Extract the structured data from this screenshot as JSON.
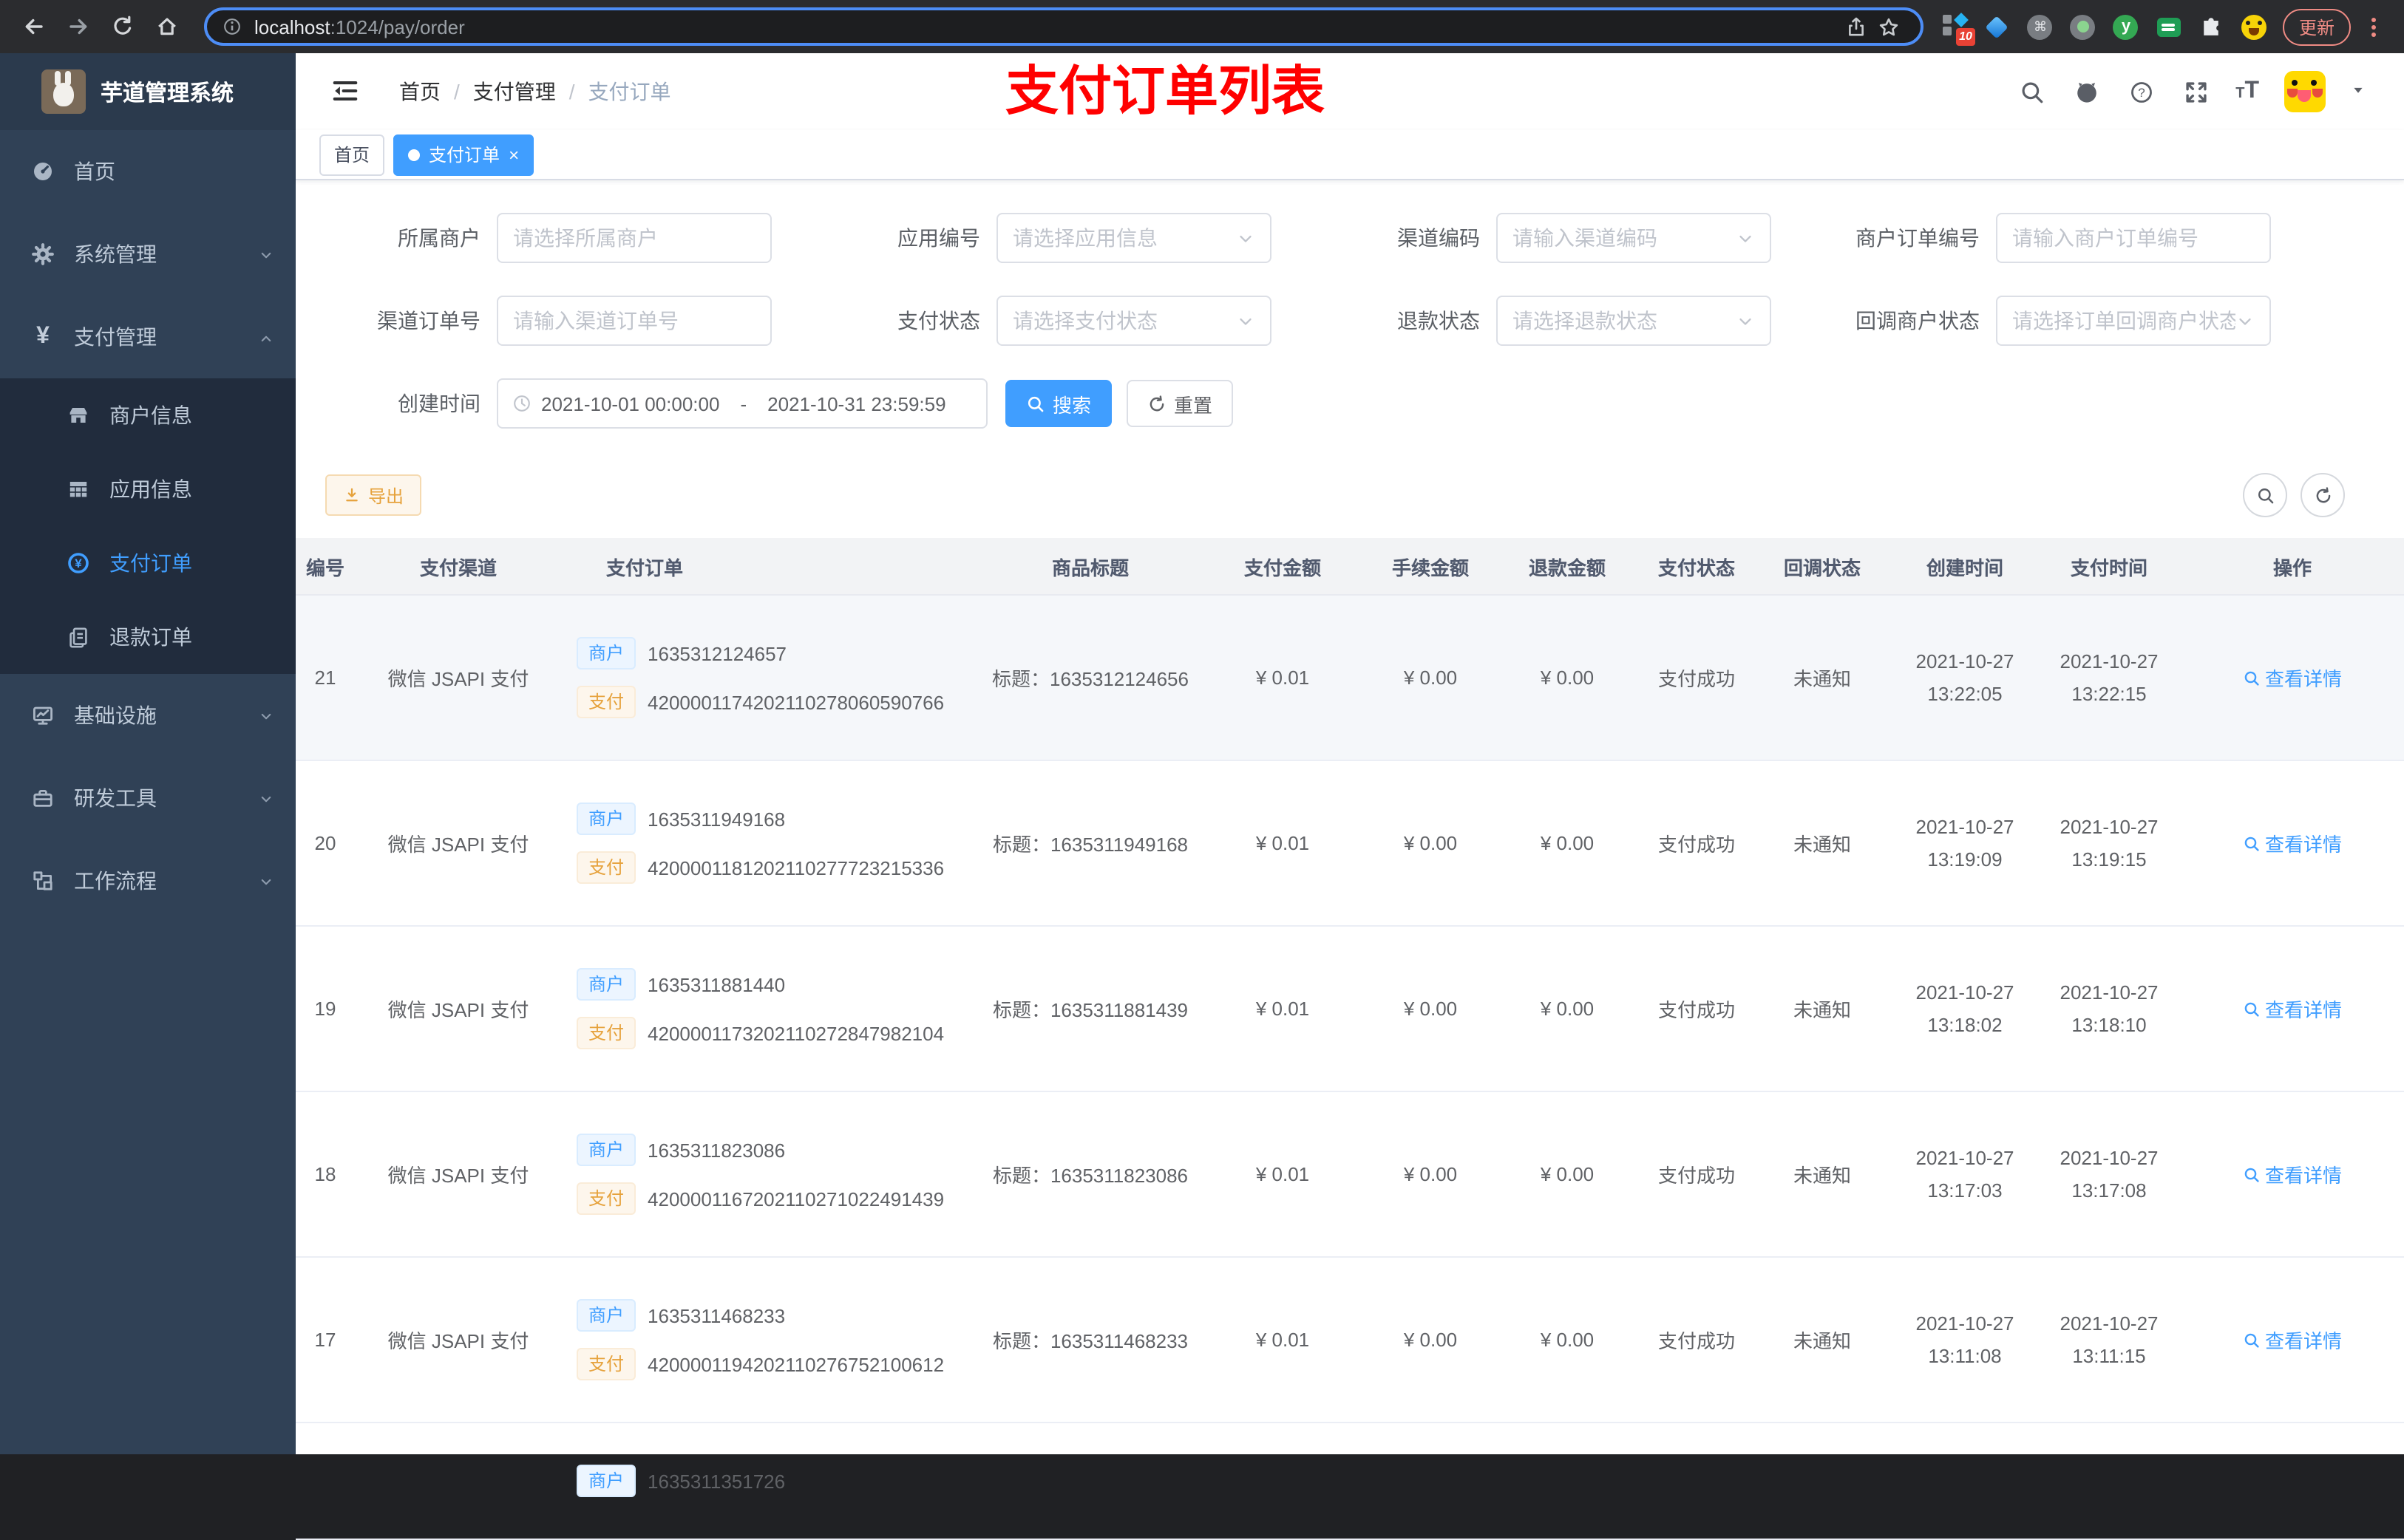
{
  "browser": {
    "url_host": "localhost",
    "url_rest": ":1024/pay/order",
    "update_label": "更新",
    "extension_badge": "10"
  },
  "sidebar": {
    "logo_title": "芋道管理系统",
    "items": [
      {
        "label": "首页",
        "icon": "dashboard-icon",
        "type": "item"
      },
      {
        "label": "系统管理",
        "icon": "gear-icon",
        "type": "group",
        "expanded": false
      },
      {
        "label": "支付管理",
        "icon": "yen-icon",
        "type": "group",
        "expanded": true,
        "children": [
          {
            "label": "商户信息",
            "icon": "shop-icon",
            "active": false
          },
          {
            "label": "应用信息",
            "icon": "grid-icon",
            "active": false
          },
          {
            "label": "支付订单",
            "icon": "pay-circle-icon",
            "active": true
          },
          {
            "label": "退款订单",
            "icon": "refund-doc-icon",
            "active": false
          }
        ]
      },
      {
        "label": "基础设施",
        "icon": "monitor-icon",
        "type": "group",
        "expanded": false
      },
      {
        "label": "研发工具",
        "icon": "toolbox-icon",
        "type": "group",
        "expanded": false
      },
      {
        "label": "工作流程",
        "icon": "workflow-icon",
        "type": "group",
        "expanded": false
      }
    ]
  },
  "header": {
    "breadcrumb": [
      "首页",
      "支付管理",
      "支付订单"
    ],
    "overlay_title": "支付订单列表"
  },
  "tabs": [
    {
      "label": "首页",
      "active": false,
      "closable": false
    },
    {
      "label": "支付订单",
      "active": true,
      "closable": true
    }
  ],
  "filters": {
    "fields": [
      {
        "label": "所属商户",
        "placeholder": "请选择所属商户",
        "type": "input"
      },
      {
        "label": "应用编号",
        "placeholder": "请选择应用信息",
        "type": "select"
      },
      {
        "label": "渠道编码",
        "placeholder": "请输入渠道编码",
        "type": "select"
      },
      {
        "label": "商户订单编号",
        "placeholder": "请输入商户订单编号",
        "type": "input"
      },
      {
        "label": "渠道订单号",
        "placeholder": "请输入渠道订单号",
        "type": "input"
      },
      {
        "label": "支付状态",
        "placeholder": "请选择支付状态",
        "type": "select"
      },
      {
        "label": "退款状态",
        "placeholder": "请选择退款状态",
        "type": "select"
      },
      {
        "label": "回调商户状态",
        "placeholder": "请选择订单回调商户状态",
        "type": "select"
      }
    ],
    "date": {
      "label": "创建时间",
      "start": "2021-10-01 00:00:00",
      "separator": "-",
      "end": "2021-10-31 23:59:59"
    },
    "search_label": "搜索",
    "reset_label": "重置"
  },
  "toolbar": {
    "export_label": "导出"
  },
  "table": {
    "columns": [
      "编号",
      "支付渠道",
      "支付订单",
      "商品标题",
      "支付金额",
      "手续金额",
      "退款金额",
      "支付状态",
      "回调状态",
      "创建时间",
      "支付时间",
      "操作"
    ],
    "merchant_tag": "商户",
    "pay_tag": "支付",
    "title_prefix": "标题：",
    "action_label": "查看详情",
    "rows": [
      {
        "id": "21",
        "channel": "微信 JSAPI 支付",
        "merchant_no": "1635312124657",
        "pay_no": "4200001174202110278060590766",
        "title": "1635312124656",
        "amount": "¥ 0.01",
        "fee": "¥ 0.00",
        "refund": "¥ 0.00",
        "pay_status": "支付成功",
        "notify_status": "未通知",
        "create_date": "2021-10-27",
        "create_time": "13:22:05",
        "pay_date": "2021-10-27",
        "pay_time": "13:22:15",
        "hover": true,
        "partial": false
      },
      {
        "id": "20",
        "channel": "微信 JSAPI 支付",
        "merchant_no": "1635311949168",
        "pay_no": "4200001181202110277723215336",
        "title": "1635311949168",
        "amount": "¥ 0.01",
        "fee": "¥ 0.00",
        "refund": "¥ 0.00",
        "pay_status": "支付成功",
        "notify_status": "未通知",
        "create_date": "2021-10-27",
        "create_time": "13:19:09",
        "pay_date": "2021-10-27",
        "pay_time": "13:19:15",
        "hover": false,
        "partial": false
      },
      {
        "id": "19",
        "channel": "微信 JSAPI 支付",
        "merchant_no": "1635311881440",
        "pay_no": "4200001173202110272847982104",
        "title": "1635311881439",
        "amount": "¥ 0.01",
        "fee": "¥ 0.00",
        "refund": "¥ 0.00",
        "pay_status": "支付成功",
        "notify_status": "未通知",
        "create_date": "2021-10-27",
        "create_time": "13:18:02",
        "pay_date": "2021-10-27",
        "pay_time": "13:18:10",
        "hover": false,
        "partial": false
      },
      {
        "id": "18",
        "channel": "微信 JSAPI 支付",
        "merchant_no": "1635311823086",
        "pay_no": "4200001167202110271022491439",
        "title": "1635311823086",
        "amount": "¥ 0.01",
        "fee": "¥ 0.00",
        "refund": "¥ 0.00",
        "pay_status": "支付成功",
        "notify_status": "未通知",
        "create_date": "2021-10-27",
        "create_time": "13:17:03",
        "pay_date": "2021-10-27",
        "pay_time": "13:17:08",
        "hover": false,
        "partial": false
      },
      {
        "id": "17",
        "channel": "微信 JSAPI 支付",
        "merchant_no": "1635311468233",
        "pay_no": "4200001194202110276752100612",
        "title": "1635311468233",
        "amount": "¥ 0.01",
        "fee": "¥ 0.00",
        "refund": "¥ 0.00",
        "pay_status": "支付成功",
        "notify_status": "未通知",
        "create_date": "2021-10-27",
        "create_time": "13:11:08",
        "pay_date": "2021-10-27",
        "pay_time": "13:11:15",
        "hover": false,
        "partial": false
      },
      {
        "id": "",
        "channel": "",
        "merchant_no": "1635311351726",
        "pay_no": "",
        "title": "",
        "amount": "",
        "fee": "",
        "refund": "",
        "pay_status": "",
        "notify_status": "",
        "create_date": "",
        "create_time": "",
        "pay_date": "",
        "pay_time": "",
        "hover": false,
        "partial": true
      }
    ]
  }
}
